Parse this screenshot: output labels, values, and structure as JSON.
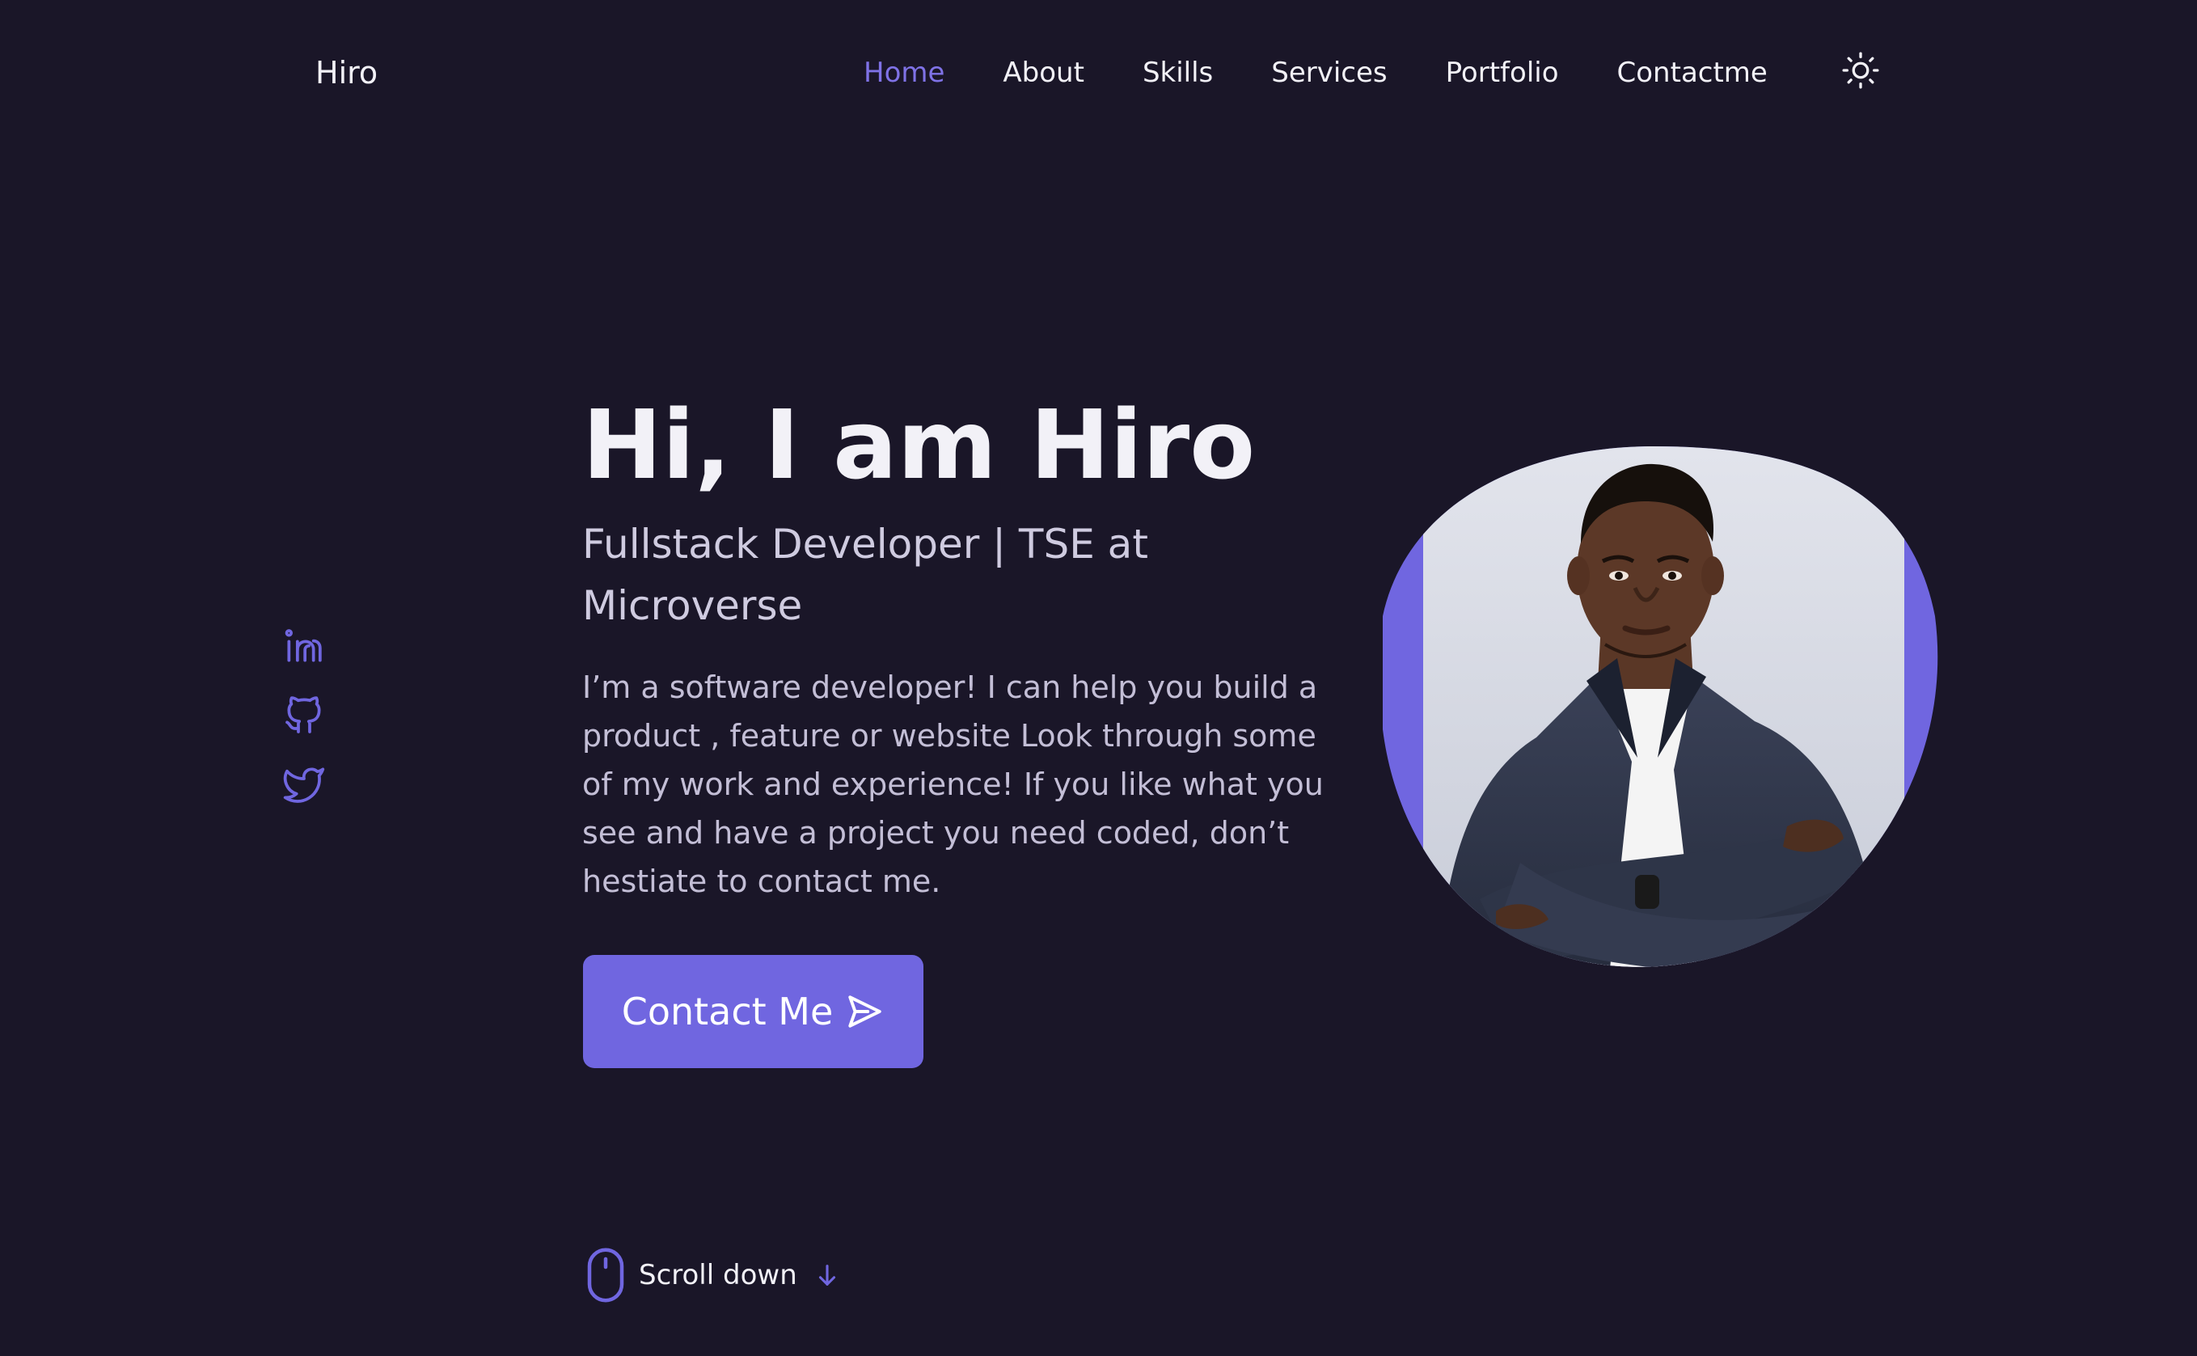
{
  "header": {
    "logo": "Hiro",
    "nav": [
      {
        "label": "Home",
        "active": true
      },
      {
        "label": "About",
        "active": false
      },
      {
        "label": "Skills",
        "active": false
      },
      {
        "label": "Services",
        "active": false
      },
      {
        "label": "Portfolio",
        "active": false
      },
      {
        "label": "Contactme",
        "active": false
      }
    ],
    "theme_toggle_icon": "sun-icon"
  },
  "social": [
    {
      "icon": "linkedin-icon"
    },
    {
      "icon": "github-icon"
    },
    {
      "icon": "twitter-icon"
    }
  ],
  "hero": {
    "title": "Hi, I am Hiro",
    "subtitle": "Fullstack Developer | TSE at Microverse",
    "description": "I’m a software developer! I can help you build a product , feature or website Look through some of my work and experience! If you like what you see and have a project you need coded, don’t hestiate to contact me.",
    "cta_label": "Contact Me",
    "cta_icon": "send-icon"
  },
  "scroll": {
    "label": "Scroll down",
    "mouse_icon": "mouse-icon",
    "arrow_icon": "arrow-down-icon"
  },
  "colors": {
    "background": "#1a1628",
    "accent": "#7066e0",
    "accent_text": "#7f72e6",
    "text": "#f2f1f7"
  }
}
